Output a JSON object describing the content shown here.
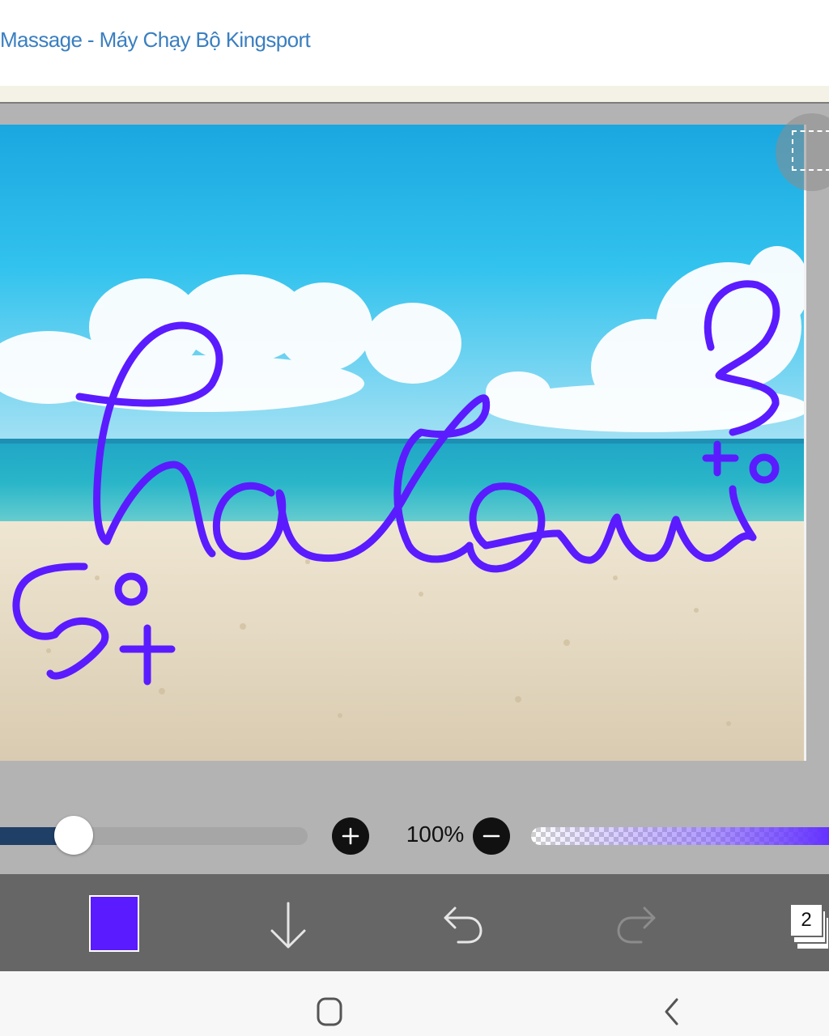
{
  "browser": {
    "page_title": "Massage - Máy Chạy Bộ Kingsport"
  },
  "canvas": {
    "drawing": {
      "main_word": "halowi",
      "stroke_color": "#5b1bff"
    }
  },
  "controls": {
    "brush_size_level": 0.24,
    "increase_icon": "plus-icon",
    "decrease_icon": "minus-icon",
    "zoom_level": "100%",
    "opacity_level": 1.0
  },
  "toolbar": {
    "current_color": "#5b1bff",
    "download_icon": "arrow-down-icon",
    "undo_icon": "undo-icon",
    "redo_icon": "redo-icon",
    "layer_count": "2"
  },
  "navigation": {
    "home_icon": "home-icon",
    "back_icon": "back-icon"
  },
  "colors": {
    "toolbar_bg": "#666666",
    "workspace_bg": "#b3b3b3",
    "title_link": "#3a7fc0"
  }
}
